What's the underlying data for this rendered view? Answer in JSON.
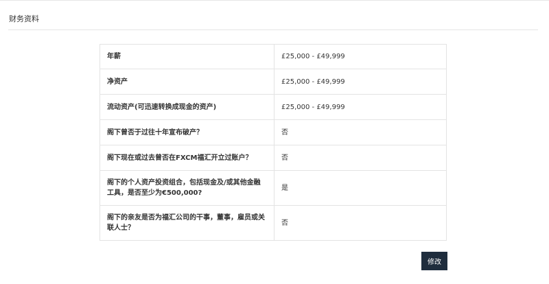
{
  "section": {
    "title": "财务资料"
  },
  "table": {
    "rows": [
      {
        "label": "年薪",
        "value": "£25,000 - £49,999"
      },
      {
        "label": "净资产",
        "value": "£25,000 - £49,999"
      },
      {
        "label": "流动资产(可迅速转换成现金的资产)",
        "value": "£25,000 - £49,999"
      },
      {
        "label": "阁下曾否于过往十年宣布破产？",
        "value": "否"
      },
      {
        "label": "阁下现在或过去曾否在FXCM福汇开立过账户？",
        "value": "否"
      },
      {
        "label": "阁下的个人资产投资组合，包括现金及/或其他金融工具，是否至少为€500,000?",
        "value": "是"
      },
      {
        "label": "阁下的亲友是否为福汇公司的干事，董事，雇员或关联人士？",
        "value": "否"
      }
    ]
  },
  "actions": {
    "edit_label": "修改"
  },
  "colors": {
    "button_background": "#1f2d3d",
    "border": "#e3e3e3"
  }
}
